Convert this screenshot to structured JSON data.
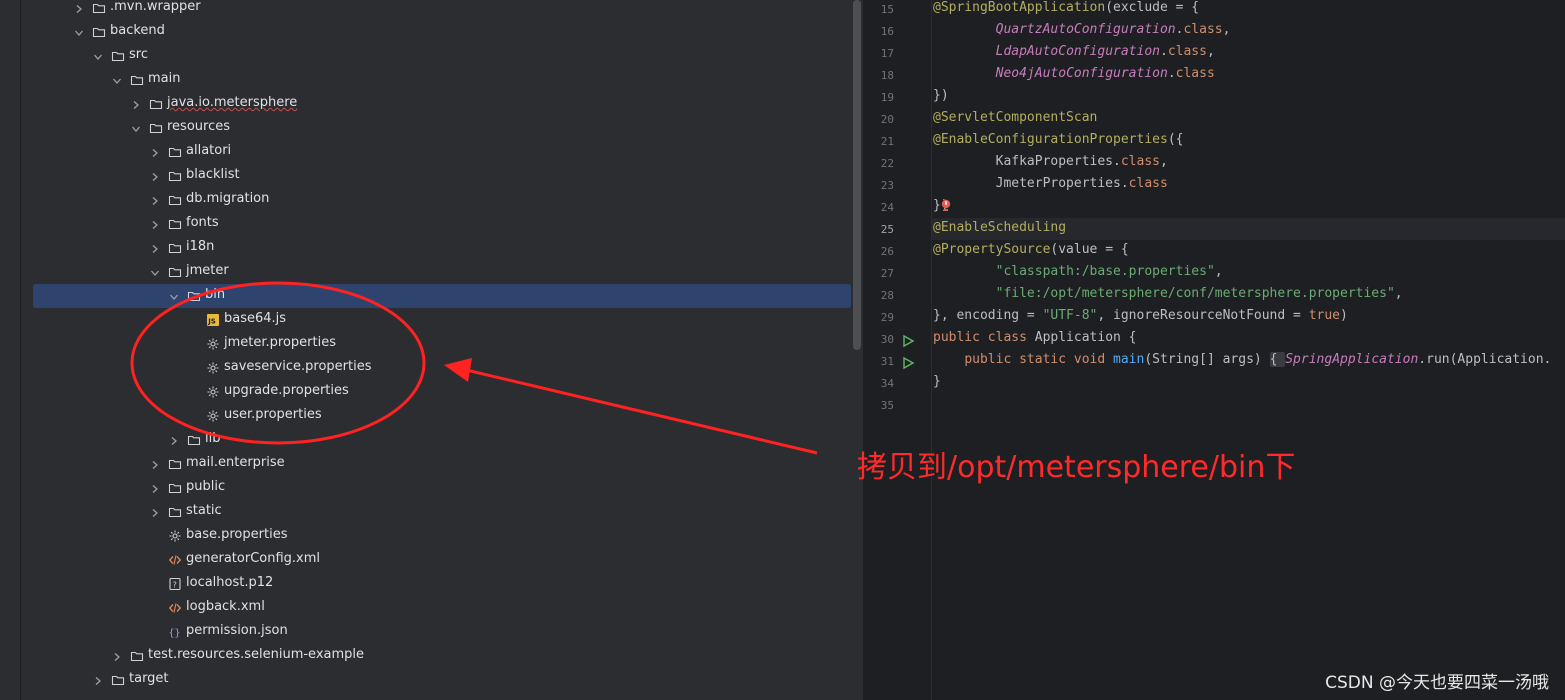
{
  "project_tree": {
    "items": [
      {
        "label": ".mvn.wrapper",
        "icon": "folder-icon",
        "chevron": "right",
        "depth": 0
      },
      {
        "label": "backend",
        "icon": "folder-icon",
        "chevron": "down",
        "depth": 0
      },
      {
        "label": "src",
        "icon": "folder-icon",
        "chevron": "down",
        "depth": 1
      },
      {
        "label": "main",
        "icon": "folder-icon",
        "chevron": "down",
        "depth": 2
      },
      {
        "label": "java.io.metersphere",
        "icon": "folder-icon",
        "chevron": "right",
        "depth": 3,
        "warn": true
      },
      {
        "label": "resources",
        "icon": "folder-icon",
        "chevron": "down",
        "depth": 3
      },
      {
        "label": "allatori",
        "icon": "folder-icon",
        "chevron": "right",
        "depth": 4
      },
      {
        "label": "blacklist",
        "icon": "folder-icon",
        "chevron": "right",
        "depth": 4
      },
      {
        "label": "db.migration",
        "icon": "folder-icon",
        "chevron": "right",
        "depth": 4
      },
      {
        "label": "fonts",
        "icon": "folder-icon",
        "chevron": "right",
        "depth": 4
      },
      {
        "label": "i18n",
        "icon": "folder-icon",
        "chevron": "right",
        "depth": 4
      },
      {
        "label": "jmeter",
        "icon": "folder-icon",
        "chevron": "down",
        "depth": 4
      },
      {
        "label": "bin",
        "icon": "folder-icon",
        "chevron": "down",
        "depth": 5,
        "selected": true
      },
      {
        "label": "base64.js",
        "icon": "js-file-icon",
        "chevron": "none",
        "depth": 6
      },
      {
        "label": "jmeter.properties",
        "icon": "gear-file-icon",
        "chevron": "none",
        "depth": 6
      },
      {
        "label": "saveservice.properties",
        "icon": "gear-file-icon",
        "chevron": "none",
        "depth": 6
      },
      {
        "label": "upgrade.properties",
        "icon": "gear-file-icon",
        "chevron": "none",
        "depth": 6
      },
      {
        "label": "user.properties",
        "icon": "gear-file-icon",
        "chevron": "none",
        "depth": 6
      },
      {
        "label": "lib",
        "icon": "folder-icon",
        "chevron": "right",
        "depth": 5
      },
      {
        "label": "mail.enterprise",
        "icon": "folder-icon",
        "chevron": "right",
        "depth": 4
      },
      {
        "label": "public",
        "icon": "folder-icon",
        "chevron": "right",
        "depth": 4
      },
      {
        "label": "static",
        "icon": "folder-icon",
        "chevron": "right",
        "depth": 4
      },
      {
        "label": "base.properties",
        "icon": "gear-file-icon",
        "chevron": "none",
        "depth": 4
      },
      {
        "label": "generatorConfig.xml",
        "icon": "xml-file-icon",
        "chevron": "none",
        "depth": 4
      },
      {
        "label": "localhost.p12",
        "icon": "unknown-file-icon",
        "chevron": "none",
        "depth": 4
      },
      {
        "label": "logback.xml",
        "icon": "xml-file-icon",
        "chevron": "none",
        "depth": 4
      },
      {
        "label": "permission.json",
        "icon": "json-file-icon",
        "chevron": "none",
        "depth": 4
      },
      {
        "label": "test.resources.selenium-example",
        "icon": "folder-icon",
        "chevron": "right",
        "depth": 2
      },
      {
        "label": "target",
        "icon": "folder-icon",
        "chevron": "right",
        "depth": 1
      }
    ]
  },
  "editor": {
    "current_line": "25",
    "lines": [
      {
        "num": "15",
        "tokens": [
          [
            "ann",
            "@SpringBootApplication"
          ],
          [
            "txt",
            "(exclude = {"
          ]
        ]
      },
      {
        "num": "16",
        "tokens": [
          [
            "txt",
            "        "
          ],
          [
            "ital",
            "QuartzAutoConfiguration"
          ],
          [
            "txt",
            "."
          ],
          [
            "kw",
            "class"
          ],
          [
            "txt",
            ","
          ]
        ]
      },
      {
        "num": "17",
        "tokens": [
          [
            "txt",
            "        "
          ],
          [
            "ital",
            "LdapAutoConfiguration"
          ],
          [
            "txt",
            "."
          ],
          [
            "kw",
            "class"
          ],
          [
            "txt",
            ","
          ]
        ]
      },
      {
        "num": "18",
        "tokens": [
          [
            "txt",
            "        "
          ],
          [
            "ital",
            "Neo4jAutoConfiguration"
          ],
          [
            "txt",
            "."
          ],
          [
            "kw",
            "class"
          ]
        ]
      },
      {
        "num": "19",
        "tokens": [
          [
            "txt",
            "})"
          ]
        ]
      },
      {
        "num": "20",
        "tokens": [
          [
            "ann",
            "@ServletComponentScan"
          ]
        ]
      },
      {
        "num": "21",
        "tokens": [
          [
            "ann",
            "@EnableConfigurationProperties"
          ],
          [
            "txt",
            "({"
          ]
        ]
      },
      {
        "num": "22",
        "tokens": [
          [
            "txt",
            "        KafkaProperties."
          ],
          [
            "kw",
            "class"
          ],
          [
            "txt",
            ","
          ]
        ]
      },
      {
        "num": "23",
        "tokens": [
          [
            "txt",
            "        JmeterProperties."
          ],
          [
            "kw",
            "class"
          ]
        ]
      },
      {
        "num": "24",
        "tokens": [
          [
            "txt",
            "})"
          ]
        ]
      },
      {
        "num": "25",
        "tokens": [
          [
            "ann",
            "@EnableScheduling"
          ]
        ]
      },
      {
        "num": "26",
        "tokens": [
          [
            "ann",
            "@PropertySource"
          ],
          [
            "txt",
            "(value = {"
          ]
        ]
      },
      {
        "num": "27",
        "tokens": [
          [
            "txt",
            "        "
          ],
          [
            "str",
            "\"classpath:/base.properties\""
          ],
          [
            "txt",
            ","
          ]
        ]
      },
      {
        "num": "28",
        "tokens": [
          [
            "txt",
            "        "
          ],
          [
            "str",
            "\"file:/opt/metersphere/conf/metersphere.properties\""
          ],
          [
            "txt",
            ","
          ]
        ]
      },
      {
        "num": "29",
        "tokens": [
          [
            "txt",
            "}, encoding = "
          ],
          [
            "str",
            "\"UTF-8\""
          ],
          [
            "txt",
            ", ignoreResourceNotFound = "
          ],
          [
            "kw",
            "true"
          ],
          [
            "txt",
            ")"
          ]
        ]
      },
      {
        "num": "30",
        "tokens": [
          [
            "kw",
            "public class "
          ],
          [
            "txt",
            "Application {"
          ]
        ]
      },
      {
        "num": "31",
        "tokens": [
          [
            "txt",
            "    "
          ],
          [
            "kw",
            "public static void "
          ],
          [
            "fn",
            "main"
          ],
          [
            "txt",
            "(String[] args) "
          ],
          [
            "fold",
            "{ "
          ],
          [
            "ital",
            "SpringApplication"
          ],
          [
            "txt",
            ".run(Application."
          ]
        ]
      },
      {
        "num": "34",
        "tokens": [
          [
            "txt",
            "}"
          ]
        ]
      },
      {
        "num": "35",
        "tokens": []
      }
    ],
    "run_lines": [
      "30",
      "31"
    ]
  },
  "annotation": {
    "text": "拷贝到/opt/metersphere/bin下",
    "color": "#ff2a2a"
  },
  "watermark": "CSDN @今天也要四菜一汤哦"
}
